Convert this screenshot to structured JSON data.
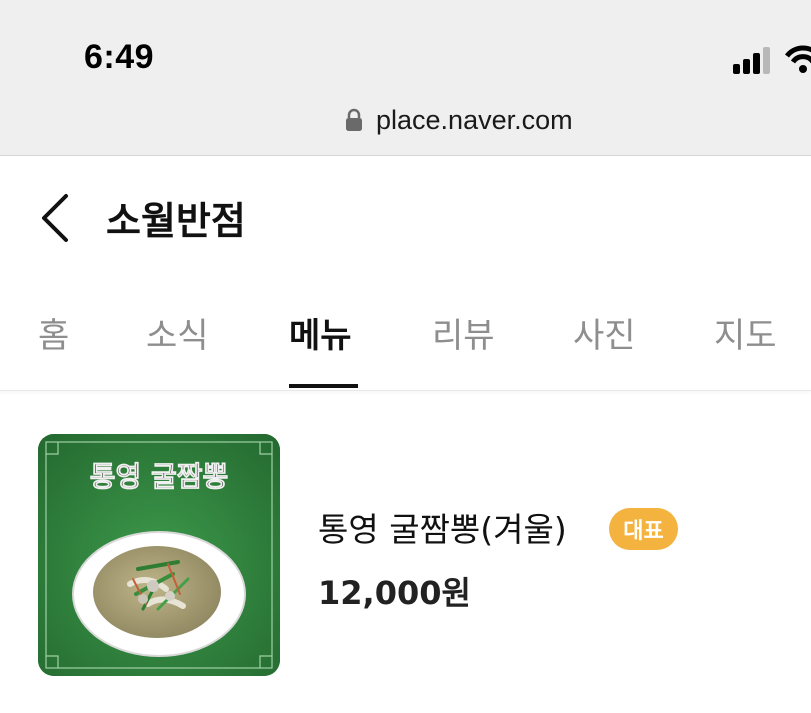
{
  "status_bar": {
    "time": "6:49"
  },
  "browser": {
    "url": "place.naver.com"
  },
  "header": {
    "title": "소월반점"
  },
  "tabs": [
    {
      "label": "홈",
      "active": false
    },
    {
      "label": "소식",
      "active": false
    },
    {
      "label": "메뉴",
      "active": true
    },
    {
      "label": "리뷰",
      "active": false
    },
    {
      "label": "사진",
      "active": false
    },
    {
      "label": "지도",
      "active": false
    }
  ],
  "menu": [
    {
      "name": "통영 굴짬뽕(겨울)",
      "badge": "대표",
      "price": "12,000원",
      "image_text": "통영 굴짬뽕"
    }
  ],
  "colors": {
    "badge": "#f4b23e",
    "image_background": "#2f7f3c",
    "active_tab": "#111111",
    "inactive_tab": "#8e8e8e"
  }
}
